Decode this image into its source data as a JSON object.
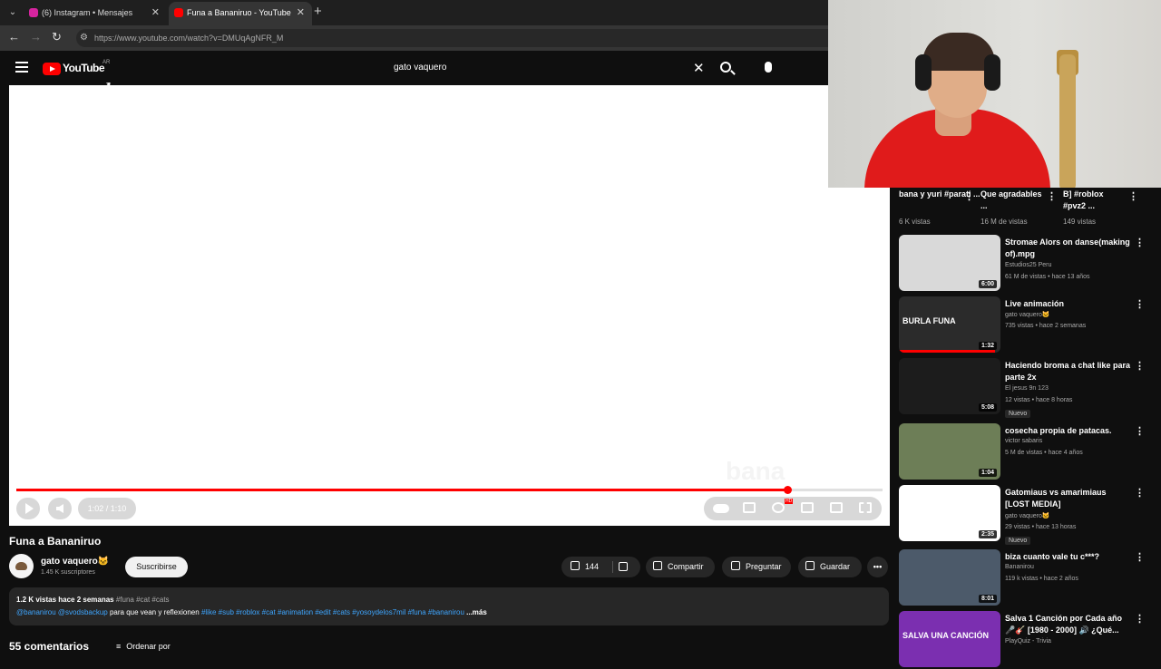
{
  "browser": {
    "tabs": [
      {
        "title": "(6) Instagram • Mensajes",
        "active": false,
        "favicon_color": "#d6249f"
      },
      {
        "title": "Funa a Bananiruo - YouTube",
        "active": true,
        "favicon_color": "#ff0000"
      }
    ],
    "url": "https://www.youtube.com/watch?v=DMUqAgNFR_M"
  },
  "youtube": {
    "logo_text": "YouTube",
    "region": "AR",
    "search_value": "gato vaquero"
  },
  "player": {
    "progress": 0.89,
    "time": "1:02 / 1:10",
    "watermark": "bana"
  },
  "video": {
    "title": "Funa a Bananiruo",
    "channel": "gato vaquero🐱",
    "subscribers": "1.45 K suscriptores",
    "subscribe_label": "Suscribirse",
    "likes": "144",
    "share_label": "Compartir",
    "ask_label": "Preguntar",
    "save_label": "Guardar",
    "more_label": "•••",
    "description": {
      "meta": "1.2 K vistas  hace 2 semanas",
      "tags": " #funa #cat #cats",
      "mentions": "@bananirou @svodsbackup",
      "text": " para que vean y reflexionen ",
      "hashtags": "#like #sub #roblox #cat #animation #edit #cats #yosoydelos7mil #funa #bananirou",
      "more": " ...más"
    },
    "comments_label": "55 comentarios",
    "sort_label": "Ordenar por"
  },
  "shorts": [
    {
      "title": "bana y yuri #parati ...",
      "views": "6 K vistas"
    },
    {
      "title": "Que agradables ...",
      "views": "16 M de vistas"
    },
    {
      "title": "B] #roblox #pvz2 ...",
      "views": "149 vistas"
    }
  ],
  "suggestions": [
    {
      "title": "Stromae  Alors on danse(making of).mpg",
      "channel": "Estudios25 Peru",
      "stats": "61 M de vistas • hace 13 años",
      "duration": "6:00",
      "badge": "",
      "watched": 0,
      "thumb_color": "#d9d9d9"
    },
    {
      "title": "Live animación",
      "channel": "gato vaquero🐱",
      "stats": "735 vistas • hace 2 semanas",
      "duration": "1:32",
      "badge": "",
      "watched": 0.95,
      "thumb_color": "#2b2b2b",
      "thumb_text": "BURLA   FUNA"
    },
    {
      "title": "Haciendo broma a chat like para parte 2x",
      "channel": "El jesus 9n 123",
      "stats": "12 vistas • hace 8 horas",
      "duration": "5:08",
      "badge": "Nuevo",
      "watched": 0,
      "thumb_color": "#1c1c1c"
    },
    {
      "title": "cosecha propia de patacas.",
      "channel": "victor sabaris",
      "stats": "5 M de vistas • hace 4 años",
      "duration": "1:04",
      "badge": "",
      "watched": 0,
      "thumb_color": "#6d7e57"
    },
    {
      "title": "Gatomiaus vs amarimiaus [LOST MEDIA]",
      "channel": "gato vaquero🐱",
      "stats": "29 vistas • hace 13 horas",
      "duration": "2:35",
      "badge": "Nuevo",
      "watched": 0,
      "thumb_color": "#ffffff"
    },
    {
      "title": "biza cuanto vale tu c***?",
      "channel": "Bananirou",
      "stats": "119 k vistas • hace 2 años",
      "duration": "8:01",
      "badge": "",
      "watched": 0,
      "thumb_color": "#4c5a6a"
    },
    {
      "title": "Salva 1 Canción por Cada año 🎤🎸 [1980 - 2000] 🔊 ¿Qué...",
      "channel": "PlayQuiz - Trivia",
      "stats": "",
      "duration": "",
      "badge": "",
      "watched": 0,
      "thumb_color": "#7b2fb0",
      "thumb_text": "SALVA UNA CANCIÓN"
    }
  ]
}
